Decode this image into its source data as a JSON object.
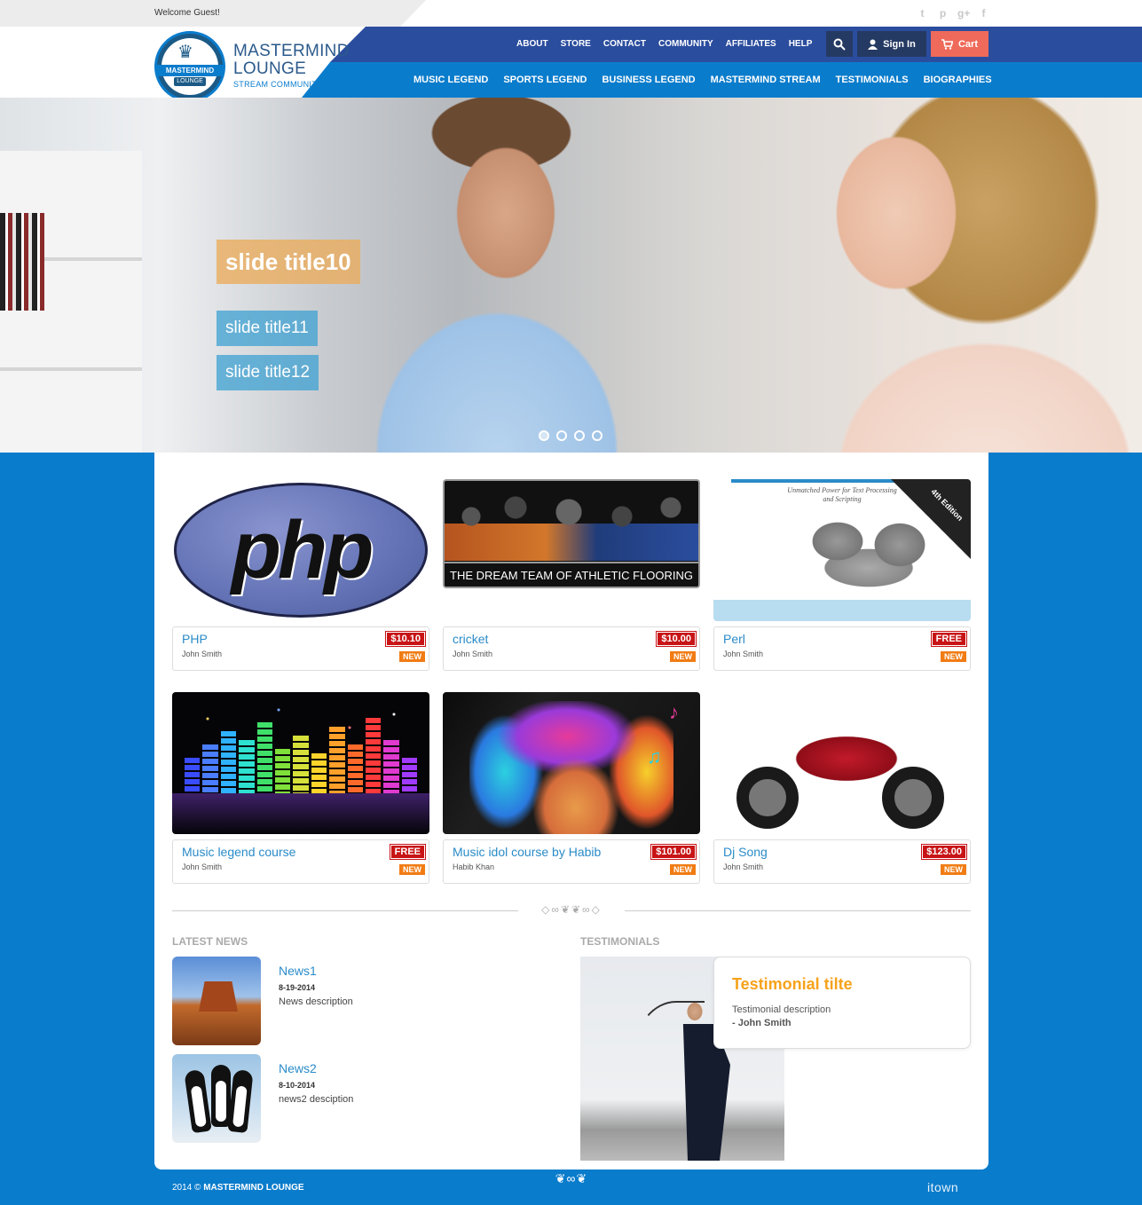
{
  "topbar": {
    "welcome": "Welcome Guest!",
    "social": [
      "twitter-icon",
      "pinterest-icon",
      "google-plus-icon",
      "facebook-icon"
    ]
  },
  "brand": {
    "line1": "MASTERMIND",
    "line2": "LOUNGE",
    "tagline": "STREAM COMMUNITY",
    "logo_ribbon": "MASTERMIND",
    "logo_sub": "LOUNGE"
  },
  "topnav": [
    "ABOUT",
    "STORE",
    "CONTACT",
    "COMMUNITY",
    "AFFILIATES",
    "HELP"
  ],
  "actions": {
    "signin": "Sign In",
    "cart": "Cart"
  },
  "catnav": [
    "MUSIC LEGEND",
    "SPORTS LEGEND",
    "BUSINESS LEGEND",
    "MASTERMIND STREAM",
    "TESTIMONIALS",
    "BIOGRAPHIES"
  ],
  "hero": {
    "title1": "slide title10",
    "title2": "slide title11",
    "title3": "slide title12",
    "slides": 4,
    "active_slide": 1
  },
  "products": [
    {
      "title": "PHP",
      "author": "John Smith",
      "price": "$10.10",
      "badge": "NEW",
      "image_text": "php"
    },
    {
      "title": "cricket",
      "author": "John Smith",
      "price": "$10.00",
      "badge": "NEW",
      "image_text": "THE DREAM TEAM OF ATHLETIC FLOORING"
    },
    {
      "title": "Perl",
      "author": "John Smith",
      "price": "FREE",
      "badge": "NEW",
      "image_text": "Unmatched Power for Text Processing and Scripting",
      "image_corner": "4th Edition"
    },
    {
      "title": "Music legend course",
      "author": "John Smith",
      "price": "FREE",
      "badge": "NEW"
    },
    {
      "title": "Music idol course by Habib",
      "author": "Habib Khan",
      "price": "$101.00",
      "badge": "NEW"
    },
    {
      "title": "Dj Song",
      "author": "John Smith",
      "price": "$123.00",
      "badge": "NEW"
    }
  ],
  "latest_news": {
    "heading": "LATEST NEWS",
    "items": [
      {
        "title": "News1",
        "date": "8-19-2014",
        "desc": "News description"
      },
      {
        "title": "News2",
        "date": "8-10-2014",
        "desc": "news2 desciption"
      }
    ]
  },
  "testimonials": {
    "heading": "TESTIMONIALS",
    "title": "Testimonial tilte",
    "desc": "Testimonial description",
    "author": "- John Smith"
  },
  "footer": {
    "year": "2014 ©",
    "name": "MASTERMIND LOUNGE",
    "credit": "itown"
  },
  "colors": {
    "nav_dark": "#2b4d9e",
    "nav_light": "#0a7ccc",
    "cart": "#ef6a5a",
    "price": "#c81416",
    "badge": "#f17c14",
    "accent": "#f7a21b"
  }
}
